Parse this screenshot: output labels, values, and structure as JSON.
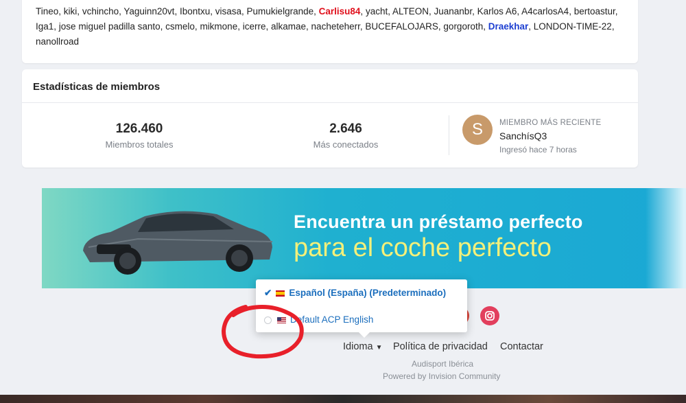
{
  "online_users": [
    {
      "name": "Tineo"
    },
    {
      "name": "kiki"
    },
    {
      "name": "vchincho"
    },
    {
      "name": "Yaguinn20vt"
    },
    {
      "name": "Ibontxu"
    },
    {
      "name": "visasa"
    },
    {
      "name": "Pumukielgrande"
    },
    {
      "name": "Carlisu84",
      "style": "red"
    },
    {
      "name": "yacht"
    },
    {
      "name": "ALTEON"
    },
    {
      "name": "Juananbr"
    },
    {
      "name": "Karlos A6"
    },
    {
      "name": "A4carlosA4"
    },
    {
      "name": "bertoastur"
    },
    {
      "name": "Iga1"
    },
    {
      "name": "jose miguel padilla santo"
    },
    {
      "name": "csmelo"
    },
    {
      "name": "mikmone"
    },
    {
      "name": "icerre"
    },
    {
      "name": "alkamae"
    },
    {
      "name": "nacheteherr"
    },
    {
      "name": "BUCEFALOJARS"
    },
    {
      "name": "gorgoroth"
    },
    {
      "name": "Draekhar",
      "style": "blue"
    },
    {
      "name": "LONDON-TIME-22"
    },
    {
      "name": "nanollroad"
    }
  ],
  "stats": {
    "title": "Estadísticas de miembros",
    "total_members": "126.460",
    "total_members_label": "Miembros totales",
    "most_online": "2.646",
    "most_online_label": "Más conectados",
    "recent_label": "MIEMBRO MÁS RECIENTE",
    "recent_avatar_letter": "S",
    "recent_name": "SanchísQ3",
    "recent_time": "Ingresó hace 7 horas"
  },
  "banner": {
    "line1": "Encuentra un préstamo perfecto",
    "line2": "para el coche perfecto"
  },
  "language_menu": {
    "selected": "Español (España) (Predeterminado)",
    "other": "Default ACP English"
  },
  "footer": {
    "language": "Idioma",
    "privacy": "Política de privacidad",
    "contact": "Contactar",
    "copyright": "Audisport Ibérica",
    "powered": "Powered by Invision Community"
  },
  "colors": {
    "username_red": "#e0101c",
    "username_blue": "#1c3ed1",
    "link_blue": "#1b6ebd",
    "banner_cyan": "#1fb0d0"
  }
}
